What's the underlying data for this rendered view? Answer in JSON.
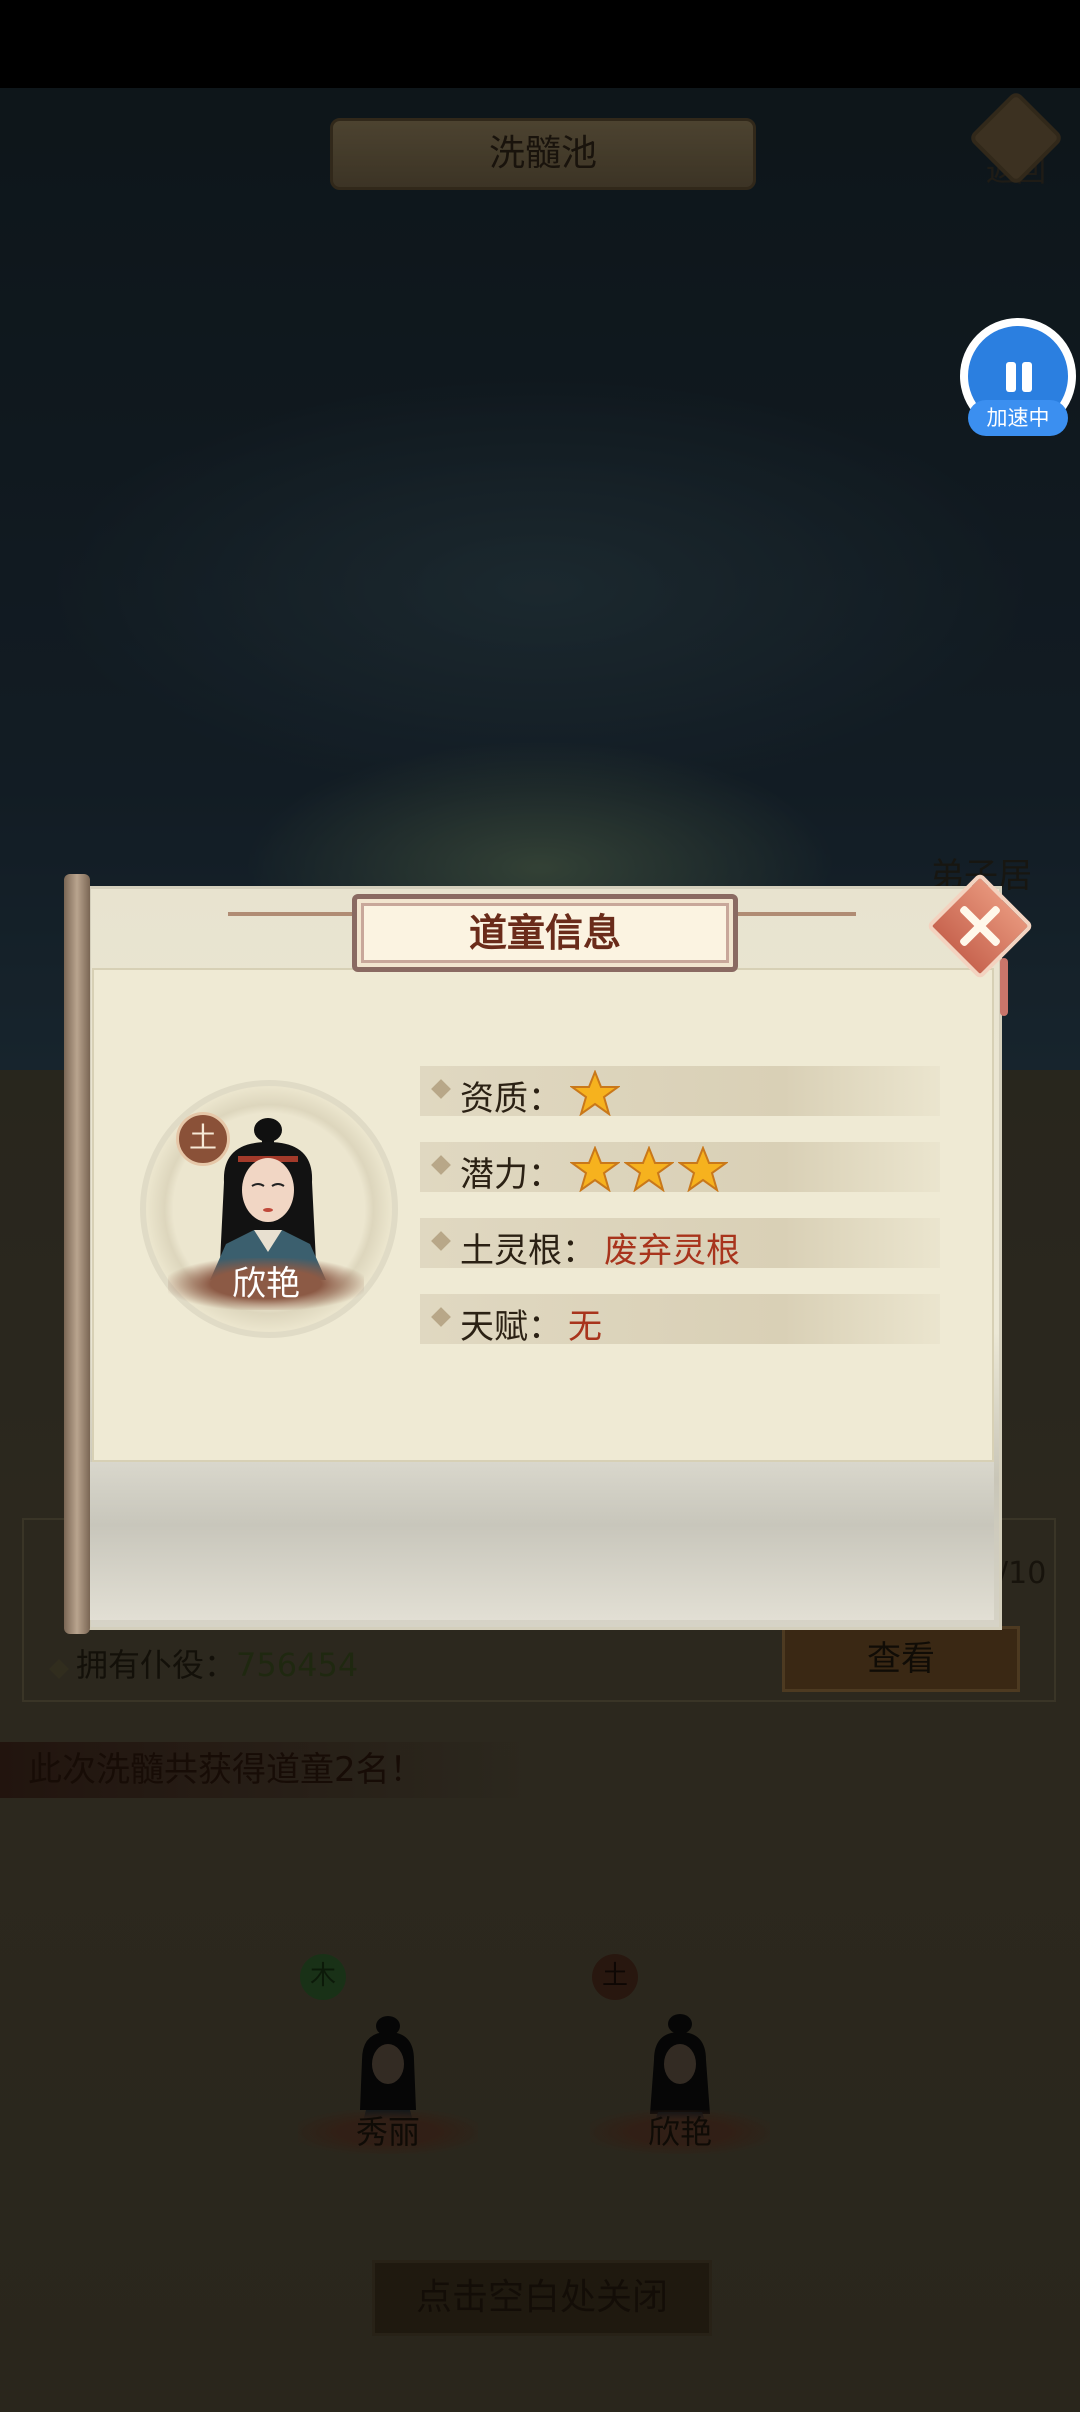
{
  "header": {
    "title": "洗髓池",
    "back_label": "返回"
  },
  "accelerate": {
    "label": "加速中",
    "icon": "pause-icon"
  },
  "side_label": "弟子居",
  "modal": {
    "title": "道童信息",
    "disciple": {
      "name": "欣艳",
      "element": "土"
    },
    "stats": [
      {
        "label": "资质：",
        "stars": 1
      },
      {
        "label": "潜力：",
        "stars": 3
      },
      {
        "label": "土灵根：",
        "value": "废弃灵根"
      },
      {
        "label": "天赋：",
        "value": "无"
      }
    ]
  },
  "background": {
    "servants_label": "拥有仆役：",
    "servants_value": "756454",
    "count_fragment": "/10",
    "view_button": "查看",
    "result_text": "此次洗髓共获得道童2名！",
    "results": [
      {
        "name": "秀丽",
        "element": "木"
      },
      {
        "name": "欣艳",
        "element": "土"
      }
    ],
    "close_hint": "点击空白处关闭"
  },
  "colors": {
    "accent_red": "#a8341c",
    "star": "#f6b21e",
    "accelerate": "#2b7fe0"
  }
}
